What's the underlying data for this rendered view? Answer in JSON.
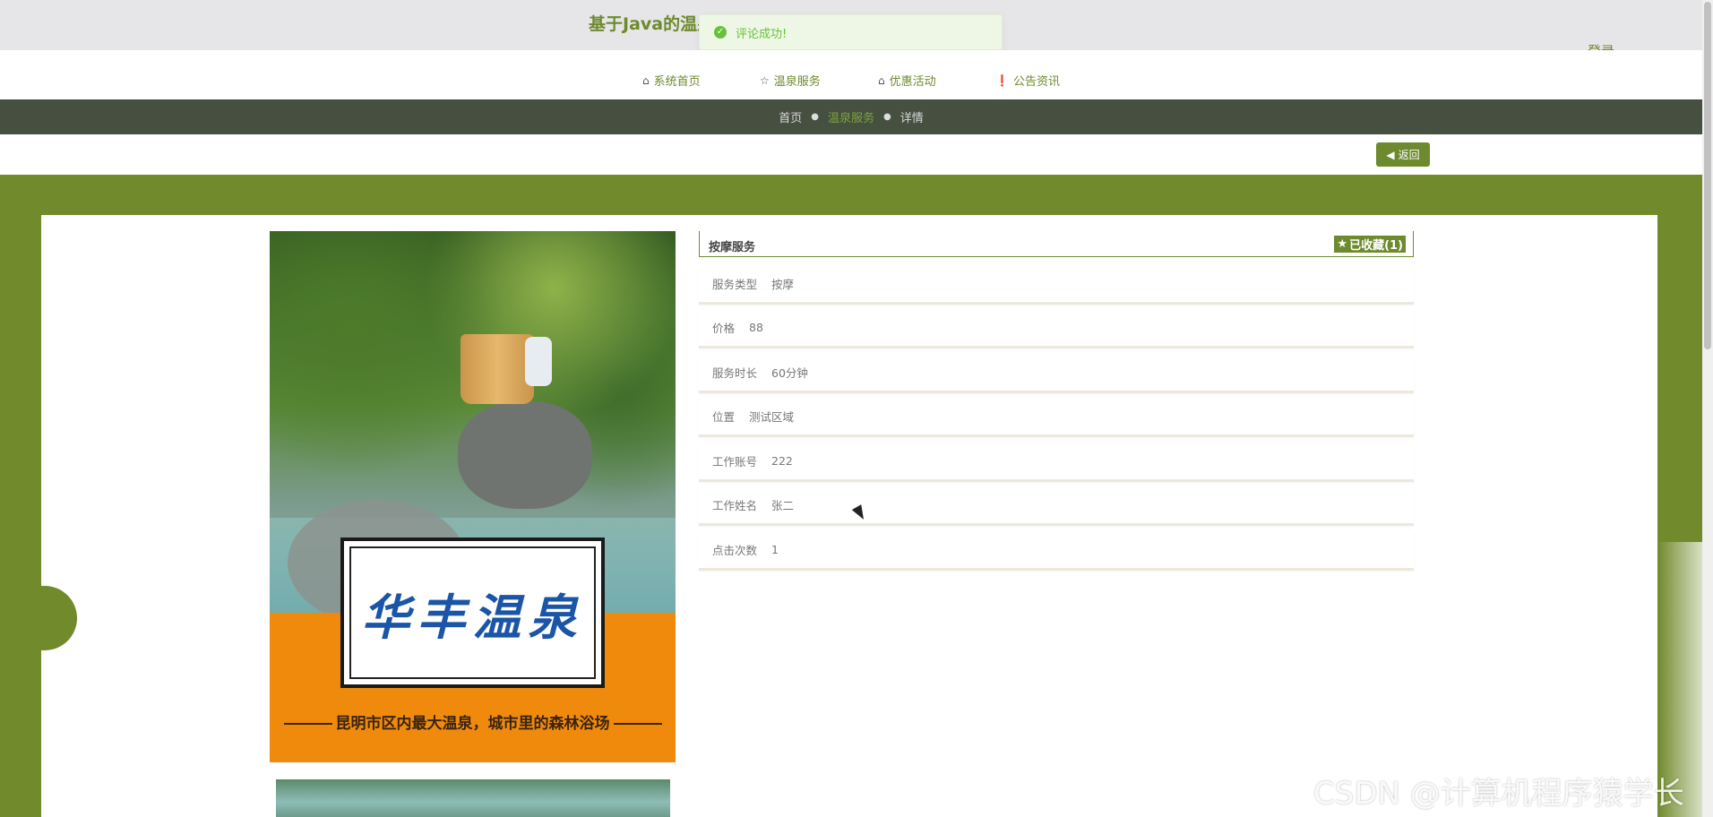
{
  "header": {
    "site_title": "基于Java的温泉",
    "login_label": "登录"
  },
  "toast": {
    "message": "评论成功!"
  },
  "nav": {
    "items": [
      {
        "label": "系统首页",
        "icon": "home-icon"
      },
      {
        "label": "温泉服务",
        "icon": "star-icon"
      },
      {
        "label": "优惠活动",
        "icon": "bag-icon"
      },
      {
        "label": "公告资讯",
        "icon": "info-icon"
      }
    ]
  },
  "breadcrumb": {
    "home": "首页",
    "section": "温泉服务",
    "current": "详情"
  },
  "back_button": {
    "label": "返回"
  },
  "poster": {
    "sign_text": "华丰温泉",
    "slogan": "昆明市区内最大温泉，城市里的森林浴场"
  },
  "detail": {
    "title": "按摩服务",
    "favorite_label": "已收藏(1)",
    "fields": [
      {
        "label": "服务类型",
        "value": "按摩"
      },
      {
        "label": "价格",
        "value": "88"
      },
      {
        "label": "服务时长",
        "value": "60分钟"
      },
      {
        "label": "位置",
        "value": "测试区域"
      },
      {
        "label": "工作账号",
        "value": "222"
      },
      {
        "label": "工作姓名",
        "value": "张二"
      },
      {
        "label": "点击次数",
        "value": "1"
      }
    ]
  },
  "watermark": "CSDN @计算机程序猿学长",
  "colors": {
    "brand_green": "#6e8a2e",
    "breadcrumb_bg": "#465040",
    "toast_success": "#67c23a"
  }
}
